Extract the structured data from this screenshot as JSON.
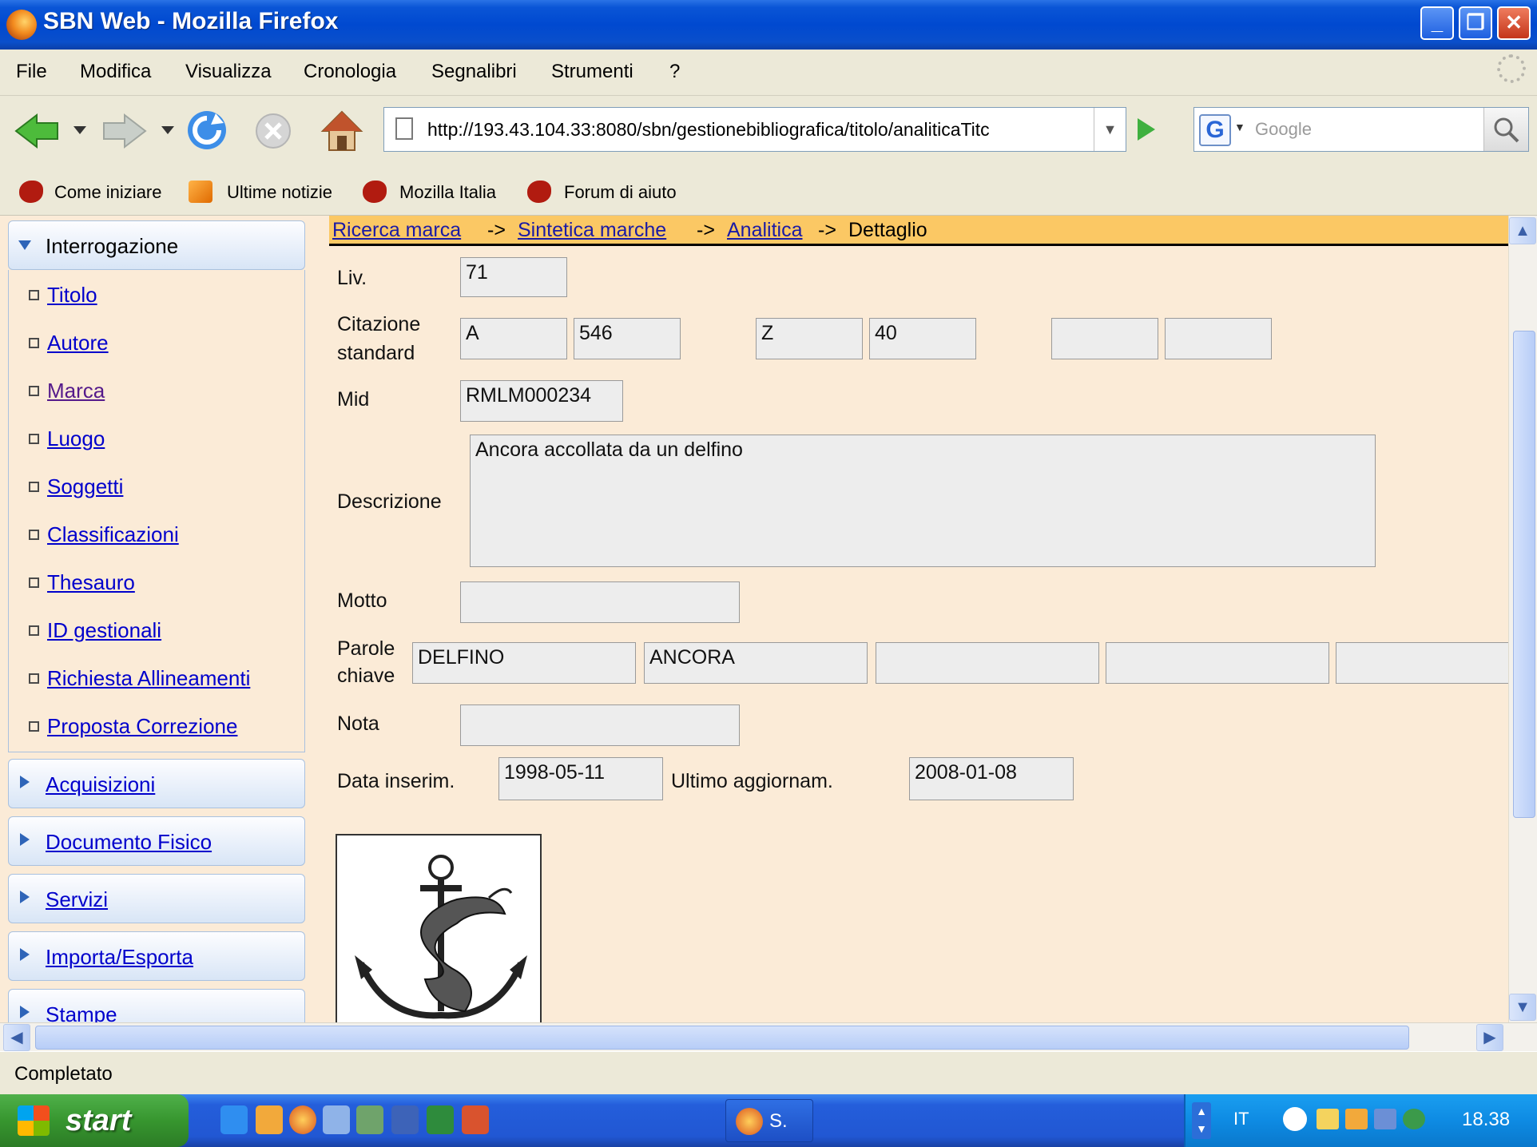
{
  "window": {
    "title": "SBN Web - Mozilla Firefox"
  },
  "menu": [
    "File",
    "Modifica",
    "Visualizza",
    "Cronologia",
    "Segnalibri",
    "Strumenti",
    "?"
  ],
  "address": {
    "url": "http://193.43.104.33:8080/sbn/gestionebibliografica/titolo/analiticaTitc"
  },
  "search": {
    "placeholder": "Google"
  },
  "bookmarks": [
    "Come iniziare",
    "Ultime notizie",
    "Mozilla Italia",
    "Forum di aiuto"
  ],
  "sidebar": {
    "section_open": "Interrogazione",
    "items": [
      "Titolo",
      "Autore",
      "Marca",
      "Luogo",
      "Soggetti",
      "Classificazioni",
      "Thesauro",
      "ID gestionali",
      "Richiesta Allineamenti",
      "Proposta Correzione"
    ],
    "sections": [
      "Acquisizioni",
      "Documento Fisico",
      "Servizi",
      "Importa/Esporta",
      "Stampe"
    ]
  },
  "breadcrumb": {
    "links": [
      "Ricerca marca",
      "Sintetica marche",
      "Analitica"
    ],
    "separator": "->",
    "current": "Dettaglio"
  },
  "form": {
    "liv_label": "Liv.",
    "liv_value": "71",
    "citazione_label_1": "Citazione",
    "citazione_label_2": "standard",
    "citazione_values": [
      "A",
      "546",
      "Z",
      "40",
      "",
      ""
    ],
    "mid_label": "Mid",
    "mid_value": "RMLM000234",
    "descrizione_label": "Descrizione",
    "descrizione_value": "Ancora accollata da un delfino",
    "motto_label": "Motto",
    "motto_value": "",
    "parole_label_1": "Parole",
    "parole_label_2": "chiave",
    "parole_values": [
      "DELFINO",
      "ANCORA",
      "",
      "",
      ""
    ],
    "nota_label": "Nota",
    "nota_value": "",
    "data_inserim_label": "Data inserim.",
    "data_inserim_value": "1998-05-11",
    "ultimo_agg_label": "Ultimo aggiornam.",
    "ultimo_agg_value": "2008-01-08"
  },
  "status": {
    "text": "Completato"
  },
  "taskbar": {
    "start_label": "start",
    "task_item": "S.",
    "language": "IT",
    "clock": "18.38"
  },
  "colors": {
    "content_bg": "#fbebd7",
    "breadcrumb_bg": "#fbc864",
    "link": "#0000cc",
    "titlebar": "#0a55d6"
  }
}
